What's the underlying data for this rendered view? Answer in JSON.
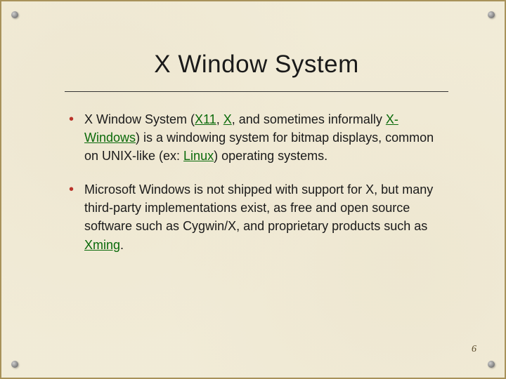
{
  "slide": {
    "title": "X Window System",
    "bullets": [
      {
        "pre": "X Window System (",
        "link1": "X11",
        "sep1": ", ",
        "link2": "X",
        "mid1": ", and sometimes informally ",
        "link3": "X-Windows",
        "mid2": ") is a windowing system for bitmap displays, common on UNIX-like (ex: ",
        "link4": "Linux",
        "post": ") operating systems."
      },
      {
        "pre": "Microsoft Windows is not shipped with support for X, but many third-party implementations exist, as free and open source software such as Cygwin/X, and proprietary products such as ",
        "link1": "Xming",
        "post": "."
      }
    ],
    "page_number": "6"
  }
}
